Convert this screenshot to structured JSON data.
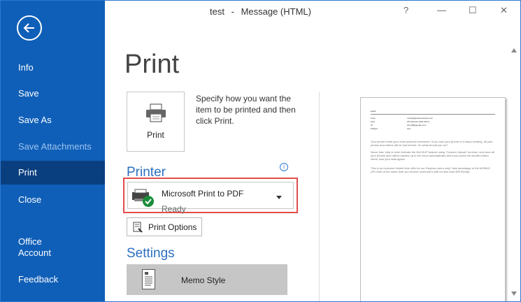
{
  "window": {
    "title_left": "test",
    "title_sep": "-",
    "title_right": "Message (HTML)",
    "controls": [
      "?",
      "—",
      "☐",
      "✕"
    ]
  },
  "sidebar": {
    "items": [
      {
        "label": "Info"
      },
      {
        "label": "Save"
      },
      {
        "label": "Save As"
      },
      {
        "label": "Save Attachments"
      },
      {
        "label": "Print"
      },
      {
        "label": "Close"
      },
      {
        "label": "Office"
      },
      {
        "label": "Account"
      },
      {
        "label": "Feedback"
      }
    ]
  },
  "print": {
    "heading": "Print",
    "button_label": "Print",
    "description": "Specify how you want the item to be printed and then click Print."
  },
  "printer": {
    "section": "Printer",
    "name": "Microsoft Print to PDF",
    "status": "Ready",
    "options_label": "Print Options"
  },
  "settings": {
    "section": "Settings",
    "style": "Memo Style"
  },
  "preview": {
    "sender": "Lord",
    "headers": [
      {
        "k": "From",
        "v": "noreply@mail.example.com"
      },
      {
        "k": "Sent",
        "v": "25 February 2021 08:41"
      },
      {
        "k": "To",
        "v": "sherrill@google.com"
      },
      {
        "k": "Subject",
        "v": "test"
      }
    ],
    "body": [
      "Your phone holds your most precious memories. If you lose your phone or it stops working, all your photos and videos will be lost forever. So what should you do?",
      "Never fear, help is here! Activate the BACKUP feature using \"Camera Upload\" function, and have all your photos and videos backed up to the cloud automatically when you press the shutter button. Never lose your data again!",
      "This is an exclusive limited time offer for our Dropbox users only! Take advantage of the MOBILE UPLOAD at the same time you receive someone's with for less than $39.99/day."
    ]
  }
}
